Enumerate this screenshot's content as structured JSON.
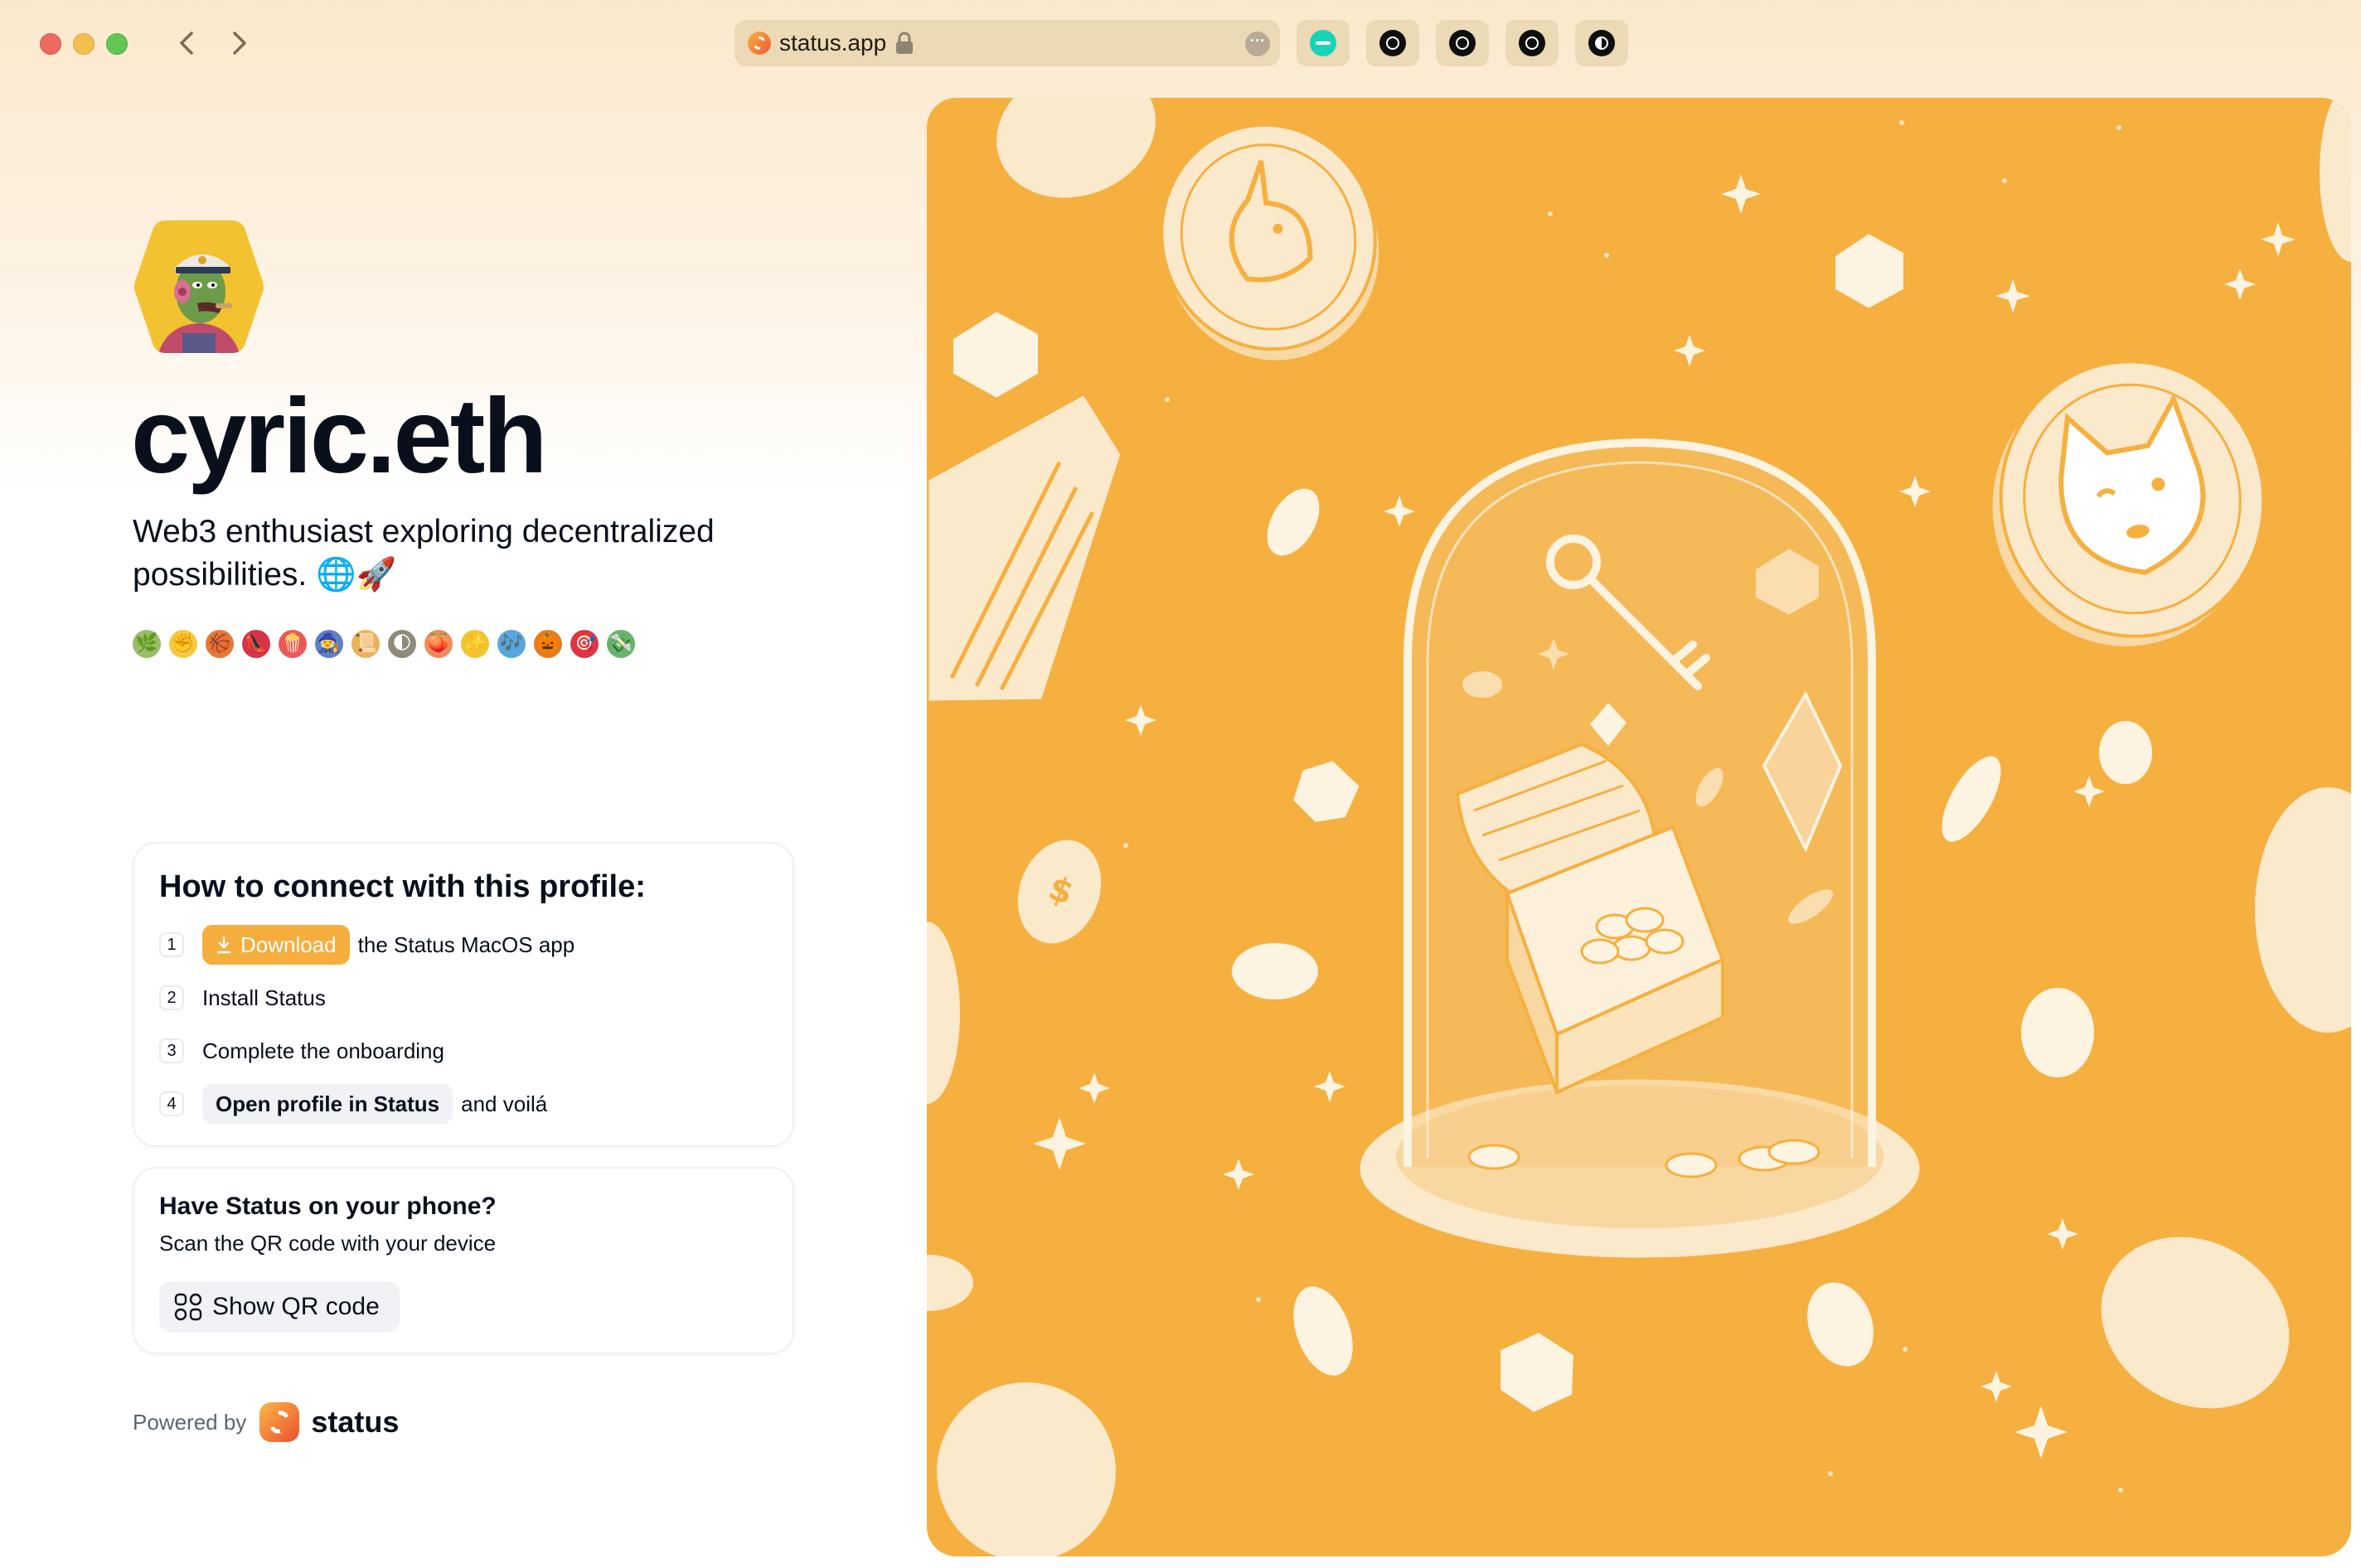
{
  "browser": {
    "url": "status.app",
    "extensions": [
      "teal-extension-icon",
      "grid-extension-icon",
      "knot-extension-icon",
      "gear-extension-icon",
      "half-moon-extension-icon"
    ]
  },
  "profile": {
    "name": "cyric.eth",
    "bio": "Web3 enthusiast exploring decentralized possibilities. 🌐🚀",
    "emojis": [
      "🌿",
      "✊",
      "🏀",
      "👠",
      "🍿",
      "🧙",
      "📜",
      "🌓",
      "🍑",
      "✨",
      "🎶",
      "🎃",
      "🎯",
      "💸"
    ]
  },
  "connect": {
    "title": "How to connect with this profile:",
    "steps": [
      {
        "num": "1",
        "button": "Download",
        "text": "the Status MacOS app"
      },
      {
        "num": "2",
        "text": "Install Status"
      },
      {
        "num": "3",
        "text": "Complete the onboarding"
      },
      {
        "num": "4",
        "button": "Open profile in Status",
        "text": "and voilá"
      }
    ]
  },
  "phone": {
    "title": "Have Status on your phone?",
    "subtitle": "Scan the QR code with your device",
    "button": "Show QR code"
  },
  "footer": {
    "powered_by": "Powered by",
    "brand": "status"
  },
  "colors": {
    "accent": "#f5ae3e",
    "hero_bg": "#f5b040",
    "text": "#09101c"
  }
}
